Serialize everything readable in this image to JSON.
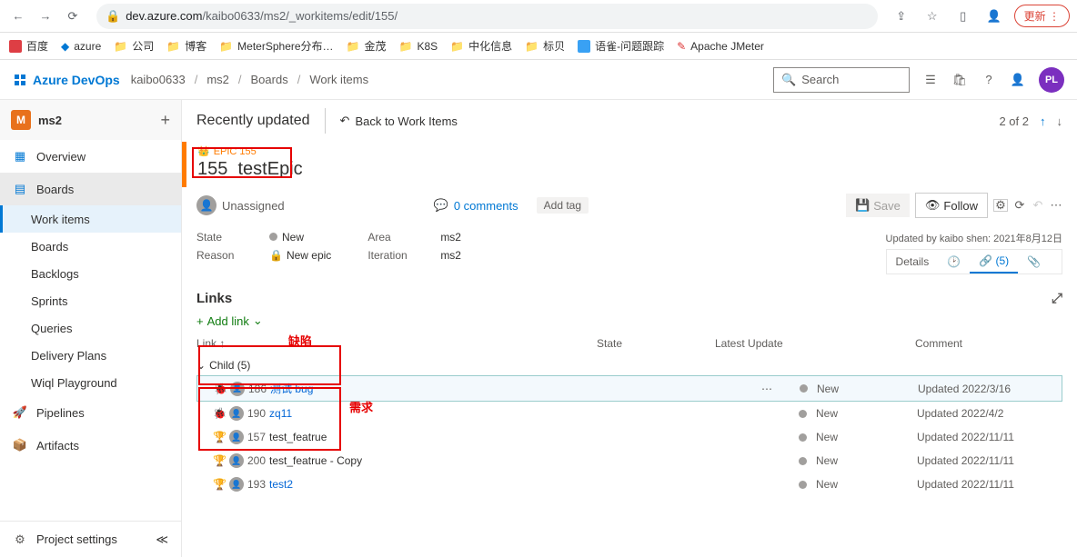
{
  "browser": {
    "url_host": "dev.azure.com",
    "url_path": "/kaibo0633/ms2/_workitems/edit/155/",
    "update_btn": "更新",
    "bookmarks": [
      "百度",
      "azure",
      "公司",
      "博客",
      "MeterSphere分布…",
      "金茂",
      "K8S",
      "中化信息",
      "标贝",
      "语雀-问题跟踪",
      "Apache JMeter"
    ]
  },
  "header": {
    "brand": "Azure DevOps",
    "crumbs": [
      "kaibo0633",
      "ms2",
      "Boards",
      "Work items"
    ],
    "search_placeholder": "Search",
    "avatar": "PL"
  },
  "sidebar": {
    "project_badge": "M",
    "project_name": "ms2",
    "items": [
      {
        "label": "Overview"
      },
      {
        "label": "Boards"
      },
      {
        "label": "Work items",
        "sub": true,
        "active": true
      },
      {
        "label": "Boards",
        "sub": true
      },
      {
        "label": "Backlogs",
        "sub": true
      },
      {
        "label": "Sprints",
        "sub": true
      },
      {
        "label": "Queries",
        "sub": true
      },
      {
        "label": "Delivery Plans",
        "sub": true
      },
      {
        "label": "Wiql Playground",
        "sub": true
      },
      {
        "label": "Pipelines"
      },
      {
        "label": "Artifacts"
      }
    ],
    "settings": "Project settings"
  },
  "content": {
    "title": "Recently updated",
    "back": "Back to Work Items",
    "pager": "2 of 2",
    "epic_tag": "EPIC 155",
    "epic_id": "155",
    "epic_title": "testEpic",
    "unassigned": "Unassigned",
    "comments": "0 comments",
    "add_tag": "Add tag",
    "save": "Save",
    "follow": "Follow",
    "state_label": "State",
    "state_value": "New",
    "reason_label": "Reason",
    "reason_value": "New epic",
    "area_label": "Area",
    "area_value": "ms2",
    "iteration_label": "Iteration",
    "iteration_value": "ms2",
    "updated_by": "Updated by kaibo shen: 2021年8月12日",
    "tabs": {
      "details": "Details",
      "links": "(5)"
    },
    "links_header": "Links",
    "add_link": "Add link",
    "columns": {
      "link": "Link",
      "state": "State",
      "updated": "Latest Update",
      "comment": "Comment"
    },
    "child_label": "Child (5)",
    "rows": [
      {
        "type": "bug",
        "id": "186",
        "title": "测试 bug",
        "link": true,
        "state": "New",
        "updated": "Updated 2022/3/16",
        "selected": true
      },
      {
        "type": "bug",
        "id": "190",
        "title": "zq11",
        "link": true,
        "state": "New",
        "updated": "Updated 2022/4/2"
      },
      {
        "type": "feature",
        "id": "157",
        "title": "test_featrue",
        "state": "New",
        "updated": "Updated 2022/11/11"
      },
      {
        "type": "feature",
        "id": "200",
        "title": "test_featrue - Copy",
        "state": "New",
        "updated": "Updated 2022/11/11"
      },
      {
        "type": "feature",
        "id": "193",
        "title": "test2",
        "link": true,
        "state": "New",
        "updated": "Updated 2022/11/11"
      }
    ]
  },
  "annotations": {
    "bug": "缺陷",
    "req": "需求"
  }
}
